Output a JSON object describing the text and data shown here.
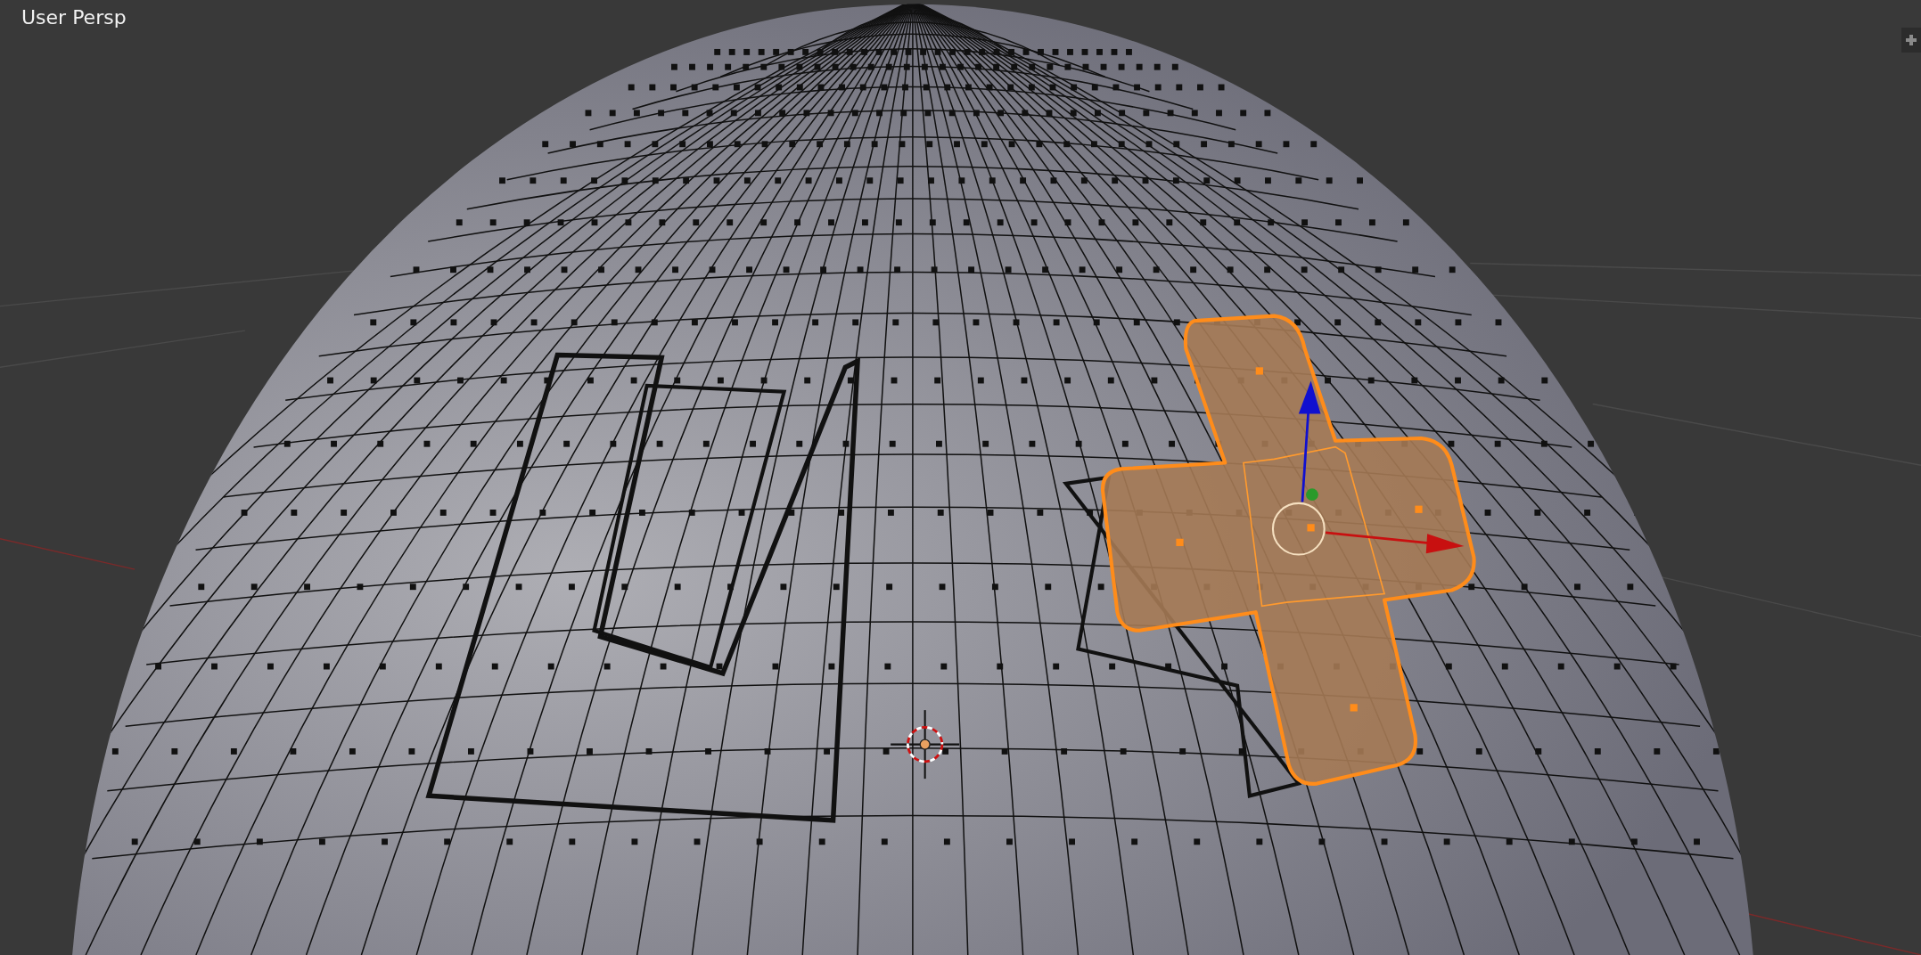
{
  "viewport": {
    "title": "User Persp"
  }
}
